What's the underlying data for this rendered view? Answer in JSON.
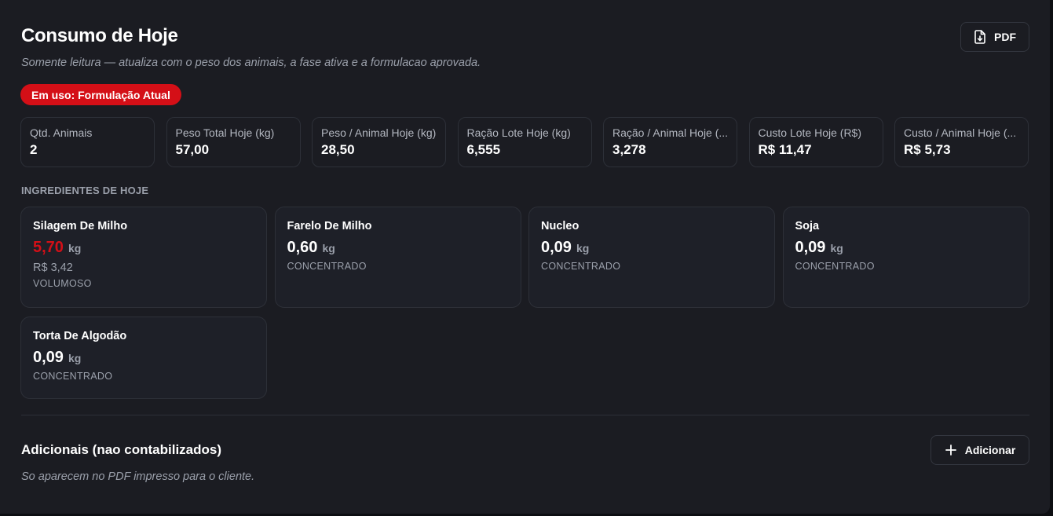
{
  "header": {
    "title": "Consumo de Hoje",
    "subtitle": "Somente leitura — atualiza com o peso dos animais, a fase ativa e a formulacao aprovada.",
    "pdf_label": "PDF",
    "pdf_icon": "file-download-icon"
  },
  "badge": {
    "label": "Em uso: Formulação Atual",
    "color": "#d40f17"
  },
  "stats": [
    {
      "label": "Qtd. Animais",
      "value": "2"
    },
    {
      "label": "Peso Total Hoje (kg)",
      "value": "57,00"
    },
    {
      "label": "Peso / Animal Hoje (kg)",
      "value": "28,50"
    },
    {
      "label": "Ração Lote Hoje (kg)",
      "value": "6,555"
    },
    {
      "label": "Ração / Animal Hoje (...",
      "value": "3,278"
    },
    {
      "label": "Custo Lote Hoje (R$)",
      "value": "R$ 11,47"
    },
    {
      "label": "Custo / Animal Hoje (...",
      "value": "R$ 5,73"
    }
  ],
  "ingredients_heading": "INGREDIENTES DE HOJE",
  "ingredients": [
    {
      "name": "Silagem De Milho",
      "qty": "5,70",
      "unit": "kg",
      "cost": "R$ 3,42",
      "category": "VOLUMOSO",
      "highlight": true
    },
    {
      "name": "Farelo De Milho",
      "qty": "0,60",
      "unit": "kg",
      "cost": "",
      "category": "CONCENTRADO",
      "highlight": false
    },
    {
      "name": "Nucleo",
      "qty": "0,09",
      "unit": "kg",
      "cost": "",
      "category": "CONCENTRADO",
      "highlight": false
    },
    {
      "name": "Soja",
      "qty": "0,09",
      "unit": "kg",
      "cost": "",
      "category": "CONCENTRADO",
      "highlight": false
    },
    {
      "name": "Torta De Algodão",
      "qty": "0,09",
      "unit": "kg",
      "cost": "",
      "category": "CONCENTRADO",
      "highlight": false
    }
  ],
  "additional": {
    "title": "Adicionais (nao contabilizados)",
    "subtitle": "So aparecem no PDF impresso para o cliente.",
    "add_label": "Adicionar",
    "add_icon": "plus-icon"
  },
  "colors": {
    "accent": "#d40f17",
    "background": "#1b1c22",
    "card": "#1e2028"
  }
}
